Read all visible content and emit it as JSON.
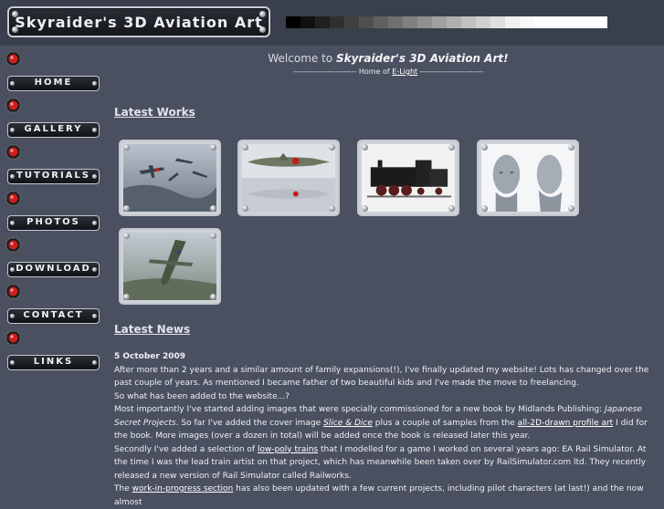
{
  "site": {
    "title": "Skyraider's 3D Aviation Art",
    "palette": [
      "#000000",
      "#101010",
      "#202020",
      "#303030",
      "#404040",
      "#505050",
      "#606060",
      "#707070",
      "#808080",
      "#909090",
      "#a0a0a0",
      "#b0b0b0",
      "#c0c0c0",
      "#d0d0d0",
      "#e0e0e0",
      "#f0f0f0",
      "#f8f8f8",
      "#ffffff",
      "#ffffff",
      "#ffffff",
      "#ffffff",
      "#ffffff"
    ]
  },
  "nav": {
    "items": [
      {
        "label": "Home"
      },
      {
        "label": "Gallery"
      },
      {
        "label": "Tutorials"
      },
      {
        "label": "Photos"
      },
      {
        "label": "Download"
      },
      {
        "label": "Contact"
      },
      {
        "label": "Links"
      }
    ],
    "gem_color": "#cc1f1f"
  },
  "welcome": {
    "prefix": "Welcome to",
    "name": "Skyraider's 3D Aviation Art!",
    "sub_left": "------------------------ Home of",
    "sub_link": "E-Light",
    "sub_right": "------------------------"
  },
  "latest_works": {
    "heading": "Latest Works",
    "items": [
      {
        "name": "dogfight"
      },
      {
        "name": "japanese-aircraft-profiles"
      },
      {
        "name": "steam-locomotive"
      },
      {
        "name": "character-heads"
      },
      {
        "name": "spitfire-dive"
      }
    ]
  },
  "latest_news": {
    "heading": "Latest News",
    "date": "5 October 2009",
    "p1": "After more than 2 years and a similar amount of family expansions(!), I've finally updated my website! Lots has changed over the past couple of years. As mentioned I became father of two beautiful kids and I've made the move to freelancing.",
    "p2": "So what has been added to the website...?",
    "p3a": "Most importantly I've started adding images that were specially commissioned for a new book by Midlands Publishing:",
    "p3_book": "Japanese Secret Projects",
    "p3b": ". So far I've added the cover image",
    "p3_link1": "Slice & Dice",
    "p3c": "plus a couple of samples from the",
    "p3_link2": "all-2D-drawn profile art",
    "p3d": "I did for the book. More images (over a dozen in total) will be added once the book is released later this year.",
    "p4a": "Secondly I've added a selection of",
    "p4_link": "low-poly trains",
    "p4b": "that I modelled for a game I worked on several years ago: EA Rail Simulator. At the time I was the lead train artist on that project, which has meanwhile been taken over by RailSimulator.com ltd. They recently released a new version of Rail Simulator called Railworks.",
    "p5a": "The",
    "p5_link": "work-in-progress section",
    "p5b": "has also been updated with a few current projects, including pilot characters (at last!) and the now almost"
  }
}
